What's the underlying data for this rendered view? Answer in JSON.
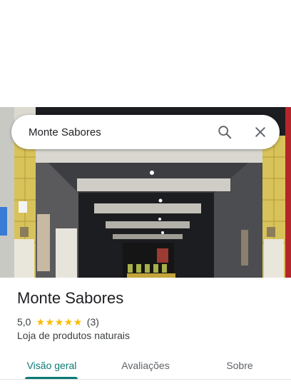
{
  "search": {
    "value": "Monte Sabores",
    "search_icon": "search-icon",
    "close_icon": "close-icon"
  },
  "place": {
    "name": "Monte Sabores",
    "rating_value": "5,0",
    "rating_stars": 5,
    "review_count": "(3)",
    "category": "Loja de produtos naturais",
    "photo_alt": "Foto do estabelecimento"
  },
  "tabs": [
    {
      "label": "Visão geral",
      "active": true
    },
    {
      "label": "Avaliações",
      "active": false
    },
    {
      "label": "Sobre",
      "active": false
    }
  ],
  "colors": {
    "accent": "#0b7a75",
    "star": "#fbbc04",
    "text_primary": "#202124",
    "text_secondary": "#3c4043"
  }
}
